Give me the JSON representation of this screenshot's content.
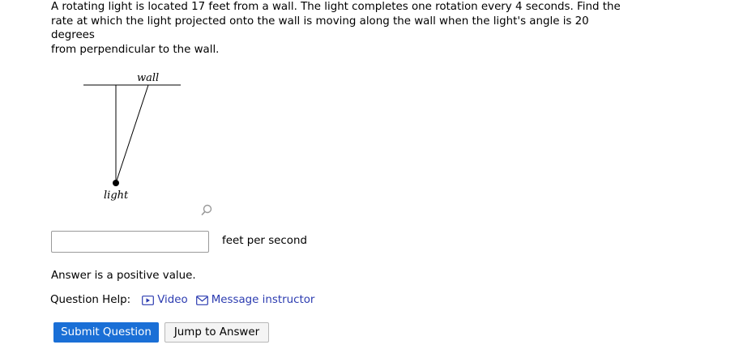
{
  "question": {
    "line1": "A rotating light is located 17 feet from a wall. The light completes one rotation every 4 seconds. Find the",
    "line2": "rate at which the light projected onto the wall is moving along the wall when the light's angle is 20 degrees",
    "line3": "from perpendicular to the wall."
  },
  "diagram": {
    "wall_label": "wall",
    "light_label": "light"
  },
  "answer": {
    "value": "",
    "units": "feet per second",
    "hint": "Answer is a positive value."
  },
  "help": {
    "label": "Question Help:",
    "video": "Video",
    "message": "Message instructor"
  },
  "buttons": {
    "submit": "Submit Question",
    "jump": "Jump to Answer"
  },
  "colors": {
    "primary": "#1a6fd6",
    "link": "#2b3bb0"
  }
}
